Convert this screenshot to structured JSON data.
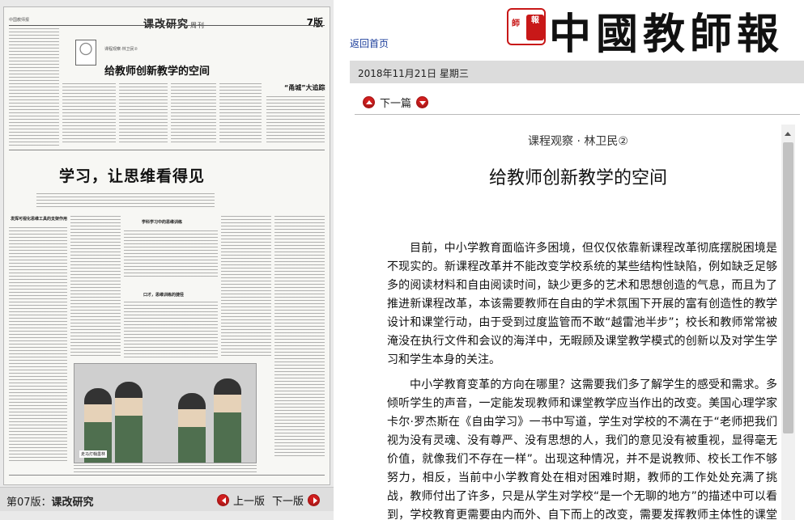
{
  "newspaper": {
    "masthead_small": "中国教师报",
    "section": "课改研究",
    "weekly": "周刊",
    "page_num": "7版",
    "headline1": "给教师创新教学的空间",
    "byline1": "课程观察·林卫民②",
    "side_title": "“甬城”大追踪",
    "headline2": "学习，让思维看得见",
    "subhead1": "发挥可视化思维工具的支架作用",
    "subhead2": "学科学习中的思维训练",
    "subhead3": "口才，思维训练的捷径",
    "photo_caption": "走马灯翰墨林"
  },
  "left_nav": {
    "edition_prefix": "第07版：",
    "edition_name": "课改研究",
    "prev_label": "上一版",
    "next_label": "下一版"
  },
  "logo": {
    "seal_left": "師",
    "seal_right": "報",
    "name": "中國教師報"
  },
  "home_link": "返回首页",
  "date": "2018年11月21日  星期三",
  "article_nav": {
    "next_label": "下一篇"
  },
  "article": {
    "kicker": "课程观察 · 林卫民②",
    "title": "给教师创新教学的空间",
    "paragraphs": [
      "目前，中小学教育面临许多困境，但仅仅依靠新课程改革彻底摆脱困境是不现实的。新课程改革并不能改变学校系统的某些结构性缺陷，例如缺乏足够多的阅读材料和自由阅读时间，缺少更多的艺术和思想创造的气息，而且为了推进新课程改革，本该需要教师在自由的学术氛围下开展的富有创造性的教学设计和课堂行动，由于受到过度监管而不敢“越雷池半步”；校长和教师常常被淹没在执行文件和会议的海洋中，无暇顾及课堂教学模式的创新以及对学生学习和学生本身的关注。",
      "中小学教育变革的方向在哪里？这需要我们多了解学生的感受和需求。多倾听学生的声音，一定能发现教师和课堂教学应当作出的改变。美国心理学家卡尔·罗杰斯在《自由学习》一书中写道，学生对学校的不满在于“老师把我们视为没有灵魂、没有尊严、没有思想的人，我们的意见没有被重视，显得毫无价值，就像我们不存在一样”。出现这种情况，并不是说教师、校长工作不够努力，相反，当前中小学教育处在相对困难时期，教师的工作处处充满了挑战，教师付出了许多，只是从学生对学校“是一个无聊的地方”的描述中可以看到，学校教育更需要由内而外、自下而上的改变，需要发挥教师主体性的课堂教学变革。如果学校过度依"
    ]
  }
}
